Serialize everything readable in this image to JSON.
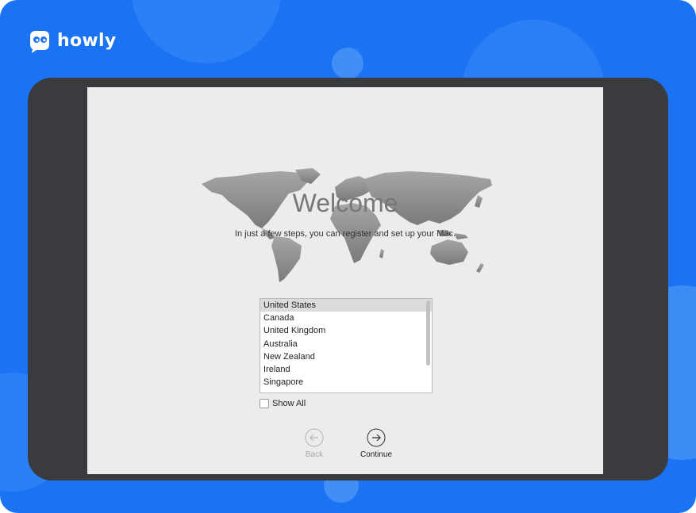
{
  "brand": {
    "name": "howly"
  },
  "setup": {
    "title": "Welcome",
    "subtitle": "In just a few steps, you can register and set up your Mac.",
    "countries": [
      "United States",
      "Canada",
      "United Kingdom",
      "Australia",
      "New Zealand",
      "Ireland",
      "Singapore"
    ],
    "selected_country": "United States",
    "show_all_label": "Show All",
    "show_all_checked": false,
    "back_label": "Back",
    "continue_label": "Continue"
  },
  "colors": {
    "background": "#1a73f2",
    "device_bezel": "#3a3b3f",
    "screen": "#ececec",
    "map": "#8d8d8d"
  },
  "icons": {
    "logo": "owl-logo-icon",
    "map": "world-map",
    "back": "back-arrow-icon",
    "continue": "forward-arrow-icon"
  }
}
